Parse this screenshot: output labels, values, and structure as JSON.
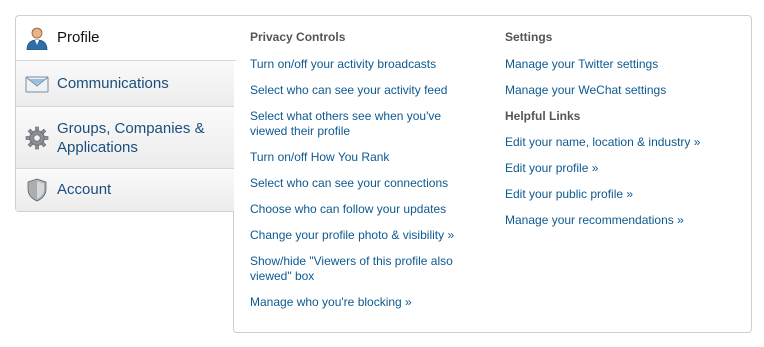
{
  "tabs": [
    {
      "label": "Profile",
      "icon": "user-icon",
      "active": true
    },
    {
      "label": "Communications",
      "icon": "envelope-icon",
      "active": false
    },
    {
      "label": "Groups, Companies & Applications",
      "icon": "gear-icon",
      "active": false
    },
    {
      "label": "Account",
      "icon": "shield-icon",
      "active": false
    }
  ],
  "privacy": {
    "heading": "Privacy Controls",
    "links": [
      "Turn on/off your activity broadcasts",
      "Select who can see your activity feed",
      "Select what others see when you've viewed their profile",
      "Turn on/off How You Rank",
      "Select who can see your connections",
      "Choose who can follow your updates",
      "Change your profile photo & visibility »",
      "Show/hide \"Viewers of this profile also viewed\" box",
      "Manage who you're blocking »"
    ]
  },
  "settings": {
    "heading": "Settings",
    "links": [
      "Manage your Twitter settings",
      "Manage your WeChat settings"
    ]
  },
  "helpful": {
    "heading": "Helpful Links",
    "links": [
      "Edit your name, location & industry »",
      "Edit your profile »",
      "Edit your public profile »",
      "Manage your recommendations »"
    ]
  },
  "colors": {
    "link": "#0d5a91",
    "tab_label": "#1a4f7d",
    "heading": "#555555"
  }
}
